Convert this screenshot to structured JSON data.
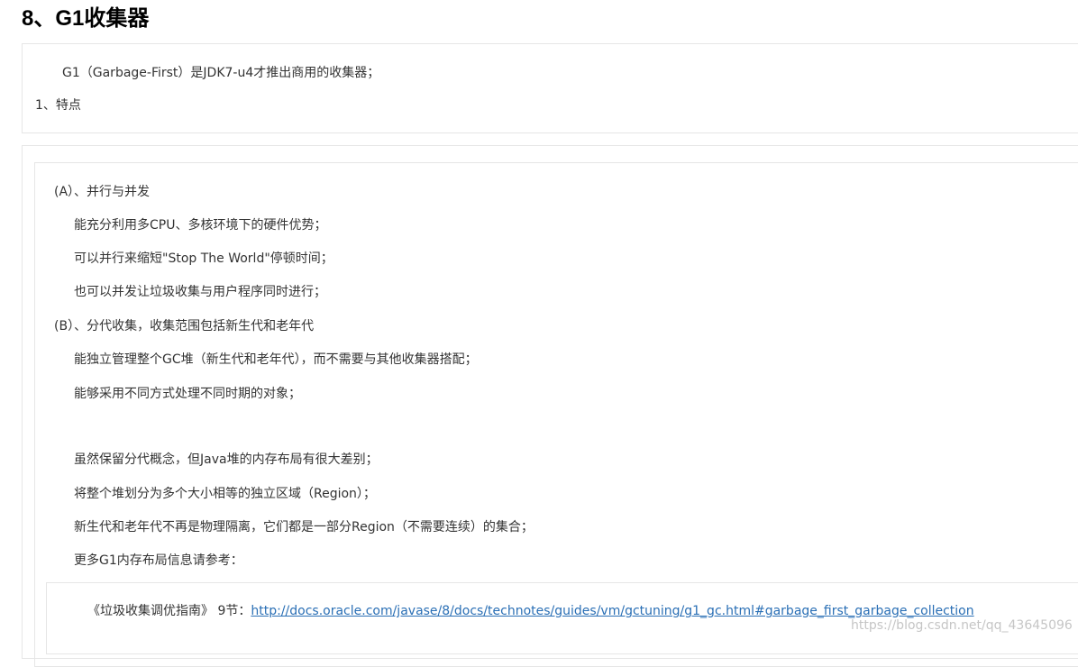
{
  "section": {
    "title": "8、G1收集器",
    "intro": "G1（Garbage-First）是JDK7-u4才推出商用的收集器；",
    "feature_heading": "1、特点"
  },
  "features": {
    "a_heading": "(A）、并行与并发",
    "a_lines": [
      "能充分利用多CPU、多核环境下的硬件优势；",
      "可以并行来缩短\"Stop The World\"停顿时间；",
      "也可以并发让垃圾收集与用户程序同时进行；"
    ],
    "b_heading": "(B）、分代收集，收集范围包括新生代和老年代",
    "b_lines": [
      "能独立管理整个GC堆（新生代和老年代），而不需要与其他收集器搭配；",
      "能够采用不同方式处理不同时期的对象；",
      "虽然保留分代概念，但Java堆的内存布局有很大差别；",
      "将整个堆划分为多个大小相等的独立区域（Region）；",
      "新生代和老年代不再是物理隔离，它们都是一部分Region（不需要连续）的集合；",
      "更多G1内存布局信息请参考："
    ]
  },
  "reference": {
    "prefix": "《垃圾收集调优指南》 9节：",
    "url": "http://docs.oracle.com/javase/8/docs/technotes/guides/vm/gctuning/g1_gc.html#garbage_first_garbage_collection"
  },
  "watermark": "https://blog.csdn.net/qq_43645096",
  "colors": {
    "text": "#333333",
    "link": "#2a6fb5",
    "border": "#e6e6e6"
  }
}
